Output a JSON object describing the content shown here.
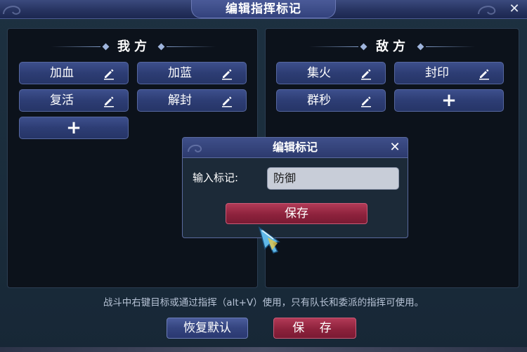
{
  "window": {
    "title": "编辑指挥标记",
    "close_glyph": "✕"
  },
  "left_panel": {
    "header": "我方",
    "tags": [
      {
        "label": "加血",
        "icon": "pencil-icon"
      },
      {
        "label": "加蓝",
        "icon": "pencil-icon"
      },
      {
        "label": "复活",
        "icon": "pencil-icon"
      },
      {
        "label": "解封",
        "icon": "pencil-icon"
      }
    ],
    "add_glyph": "+"
  },
  "right_panel": {
    "header": "敌方",
    "tags": [
      {
        "label": "集火",
        "icon": "pencil-icon"
      },
      {
        "label": "封印",
        "icon": "pencil-icon"
      },
      {
        "label": "群秒",
        "icon": "pencil-icon"
      }
    ],
    "add_glyph": "+"
  },
  "hint": "战斗中右键目标或通过指挥（alt+V）使用，只有队长和委派的指挥可使用。",
  "footer": {
    "reset_label": "恢复默认",
    "save_label": "保 存"
  },
  "dialog": {
    "title": "编辑标记",
    "close_glyph": "✕",
    "input_label": "输入标记:",
    "input_value": "防御",
    "save_label": "保存"
  },
  "colors": {
    "accent_blue": "#2d3d74",
    "accent_red": "#8d223c",
    "panel_bg": "#0c121b"
  }
}
